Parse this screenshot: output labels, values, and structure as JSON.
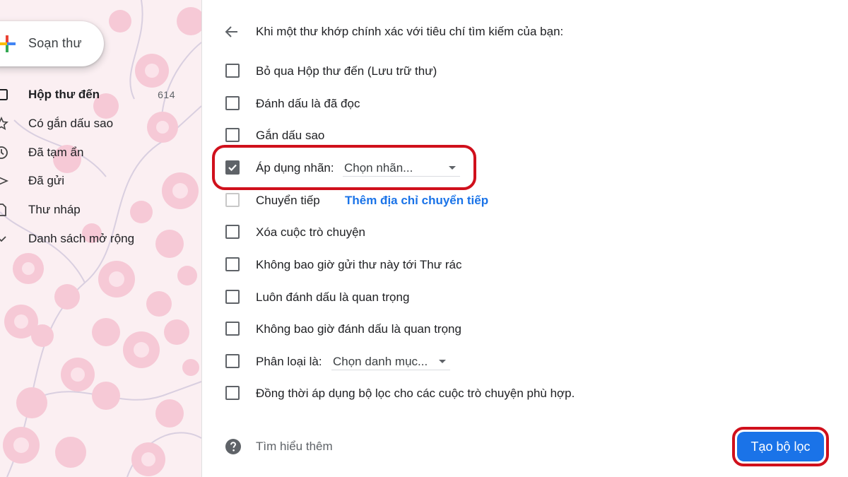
{
  "sidebar": {
    "compose_label": "Soạn thư",
    "items": [
      {
        "label": "Hộp thư đến",
        "count": "614",
        "icon": "inbox-icon",
        "active": true
      },
      {
        "label": "Có gắn dấu sao",
        "count": "",
        "icon": "star-icon"
      },
      {
        "label": "Đã tạm ẩn",
        "count": "",
        "icon": "clock-icon"
      },
      {
        "label": "Đã gửi",
        "count": "",
        "icon": "send-icon"
      },
      {
        "label": "Thư nháp",
        "count": "",
        "icon": "draft-icon"
      },
      {
        "label": "Danh sách mở rộng",
        "count": "",
        "icon": "chevron-down-icon"
      }
    ]
  },
  "panel": {
    "header": "Khi một thư khớp chính xác với tiêu chí tìm kiếm của bạn:",
    "options": {
      "skip_inbox": {
        "label": "Bỏ qua Hộp thư đến (Lưu trữ thư)",
        "checked": false
      },
      "mark_read": {
        "label": "Đánh dấu là đã đọc",
        "checked": false
      },
      "star_it": {
        "label": "Gắn dấu sao",
        "checked": false
      },
      "apply_label": {
        "label": "Áp dụng nhãn:",
        "checked": true,
        "select_value": "Chọn nhãn..."
      },
      "forward": {
        "label": "Chuyển tiếp",
        "checked": false,
        "link": "Thêm địa chỉ chuyển tiếp"
      },
      "delete": {
        "label": "Xóa cuộc trò chuyện",
        "checked": false
      },
      "never_spam": {
        "label": "Không bao giờ gửi thư này tới Thư rác",
        "checked": false
      },
      "always_important": {
        "label": "Luôn đánh dấu là quan trọng",
        "checked": false
      },
      "never_important": {
        "label": "Không bao giờ đánh dấu là quan trọng",
        "checked": false
      },
      "categorize": {
        "label": "Phân loại là:",
        "checked": false,
        "select_value": "Chọn danh mục..."
      },
      "also_apply": {
        "label": "Đồng thời áp dụng bộ lọc cho các cuộc trò chuyện phù hợp.",
        "checked": false
      }
    },
    "help_text": "Tìm hiểu thêm",
    "create_button": "Tạo bộ lọc"
  },
  "colors": {
    "accent": "#1a73e8",
    "highlight": "#d0101c",
    "sidebar_bg": "#fbeff2",
    "blossom": "#f6c9d6"
  }
}
